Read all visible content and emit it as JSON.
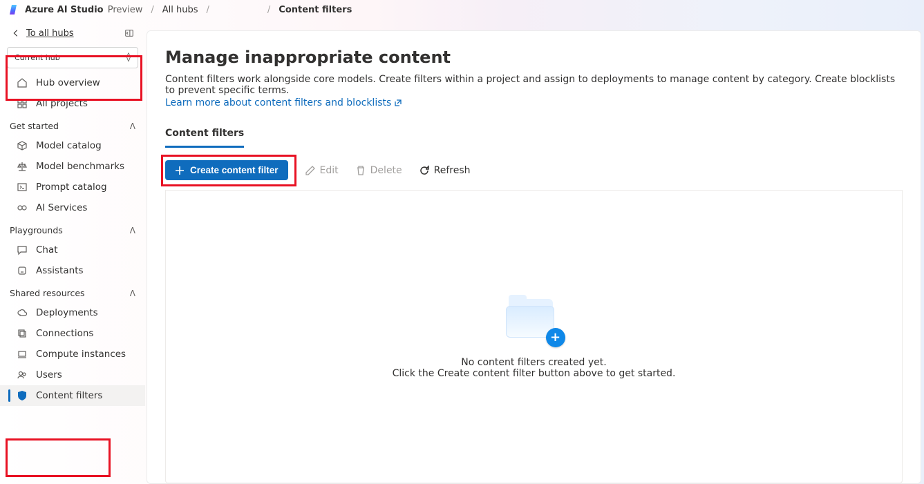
{
  "breadcrumb": {
    "app_name": "Azure AI Studio",
    "preview": "Preview",
    "items": [
      "All hubs",
      "",
      "Content filters"
    ]
  },
  "sidebar": {
    "back_label": "To all hubs",
    "hub_picker_label": "Current hub",
    "top_items": [
      {
        "label": "Hub overview",
        "icon": "home-icon"
      },
      {
        "label": "All projects",
        "icon": "grid-icon"
      }
    ],
    "sections": [
      {
        "title": "Get started",
        "items": [
          {
            "label": "Model catalog",
            "icon": "cube-icon"
          },
          {
            "label": "Model benchmarks",
            "icon": "scales-icon"
          },
          {
            "label": "Prompt catalog",
            "icon": "prompt-icon"
          },
          {
            "label": "AI Services",
            "icon": "link-icon"
          }
        ]
      },
      {
        "title": "Playgrounds",
        "items": [
          {
            "label": "Chat",
            "icon": "chat-icon"
          },
          {
            "label": "Assistants",
            "icon": "assistant-icon"
          }
        ]
      },
      {
        "title": "Shared resources",
        "items": [
          {
            "label": "Deployments",
            "icon": "cloud-icon"
          },
          {
            "label": "Connections",
            "icon": "stack-icon"
          },
          {
            "label": "Compute instances",
            "icon": "laptop-icon"
          },
          {
            "label": "Users",
            "icon": "users-icon"
          },
          {
            "label": "Content filters",
            "icon": "shield-icon",
            "active": true
          }
        ]
      }
    ]
  },
  "page": {
    "title": "Manage inappropriate content",
    "description": "Content filters work alongside core models. Create filters within a project and assign to deployments to manage content by category. Create blocklists to prevent specific terms.",
    "learn_more": "Learn more about content filters and blocklists",
    "tab_label": "Content filters"
  },
  "toolbar": {
    "create_label": "Create content filter",
    "edit_label": "Edit",
    "delete_label": "Delete",
    "refresh_label": "Refresh"
  },
  "empty": {
    "line1": "No content filters created yet.",
    "line2": "Click the Create content filter button above to get started."
  }
}
